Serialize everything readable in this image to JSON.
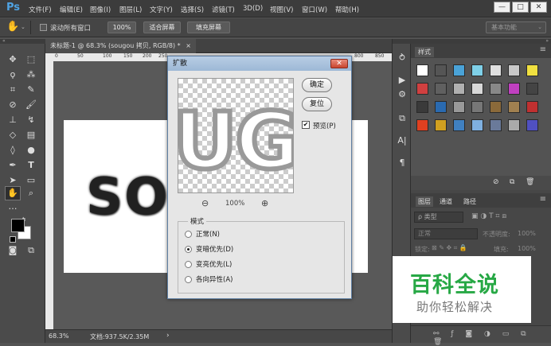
{
  "menubar": {
    "logo": "Ps",
    "items": [
      "文件(F)",
      "编辑(E)",
      "图像(I)",
      "图层(L)",
      "文字(Y)",
      "选择(S)",
      "滤镜(T)",
      "3D(D)",
      "视图(V)",
      "窗口(W)",
      "帮助(H)"
    ],
    "win_min": "—",
    "win_max": "□",
    "win_close": "✕"
  },
  "options": {
    "scroll_all_label": "滚动所有窗口",
    "zoom_value": "100%",
    "fit_screen": "适合屏幕",
    "fill_screen": "填充屏幕",
    "workspace": "基本功能"
  },
  "document": {
    "tab_title": "未标题-1 @ 68.3% (sougou 拷贝, RGB/8) *",
    "tab_close": "×",
    "canvas_text": "SO",
    "zoom": "68.3%",
    "doc_size": "文档:937.5K/2.35M",
    "ruler_marks": [
      "0",
      "50",
      "100",
      "150",
      "200",
      "250"
    ],
    "ruler_right_marks": [
      "800",
      "850"
    ]
  },
  "styles_panel": {
    "title": "样式"
  },
  "layers_panel": {
    "tabs": [
      "图层",
      "通道",
      "路径"
    ],
    "kind_filter": "ρ 类型",
    "blend_mode": "正常",
    "opacity_label": "不透明度:",
    "opacity_value": "100%",
    "lock_label": "锁定:",
    "fill_label": "填充:",
    "fill_value": "100%"
  },
  "dialog": {
    "title": "扩散",
    "preview_text": "UG",
    "ok": "确定",
    "reset": "复位",
    "preview_label": "预览(P)",
    "preview_checked": true,
    "zoom_out": "⊖",
    "zoom_level": "100%",
    "zoom_in": "⊕",
    "mode_title": "模式",
    "modes": [
      "正常(N)",
      "变暗优先(D)",
      "变亮优先(L)",
      "各向异性(A)"
    ],
    "selected_mode_index": 1
  },
  "watermark": {
    "line1": "百科全说",
    "line2": "助你轻松解决"
  },
  "colors": {
    "accent_blue": "#4fa3e3",
    "watermark_green": "#27a845",
    "dialog_title_bg": "#9db8d6"
  }
}
